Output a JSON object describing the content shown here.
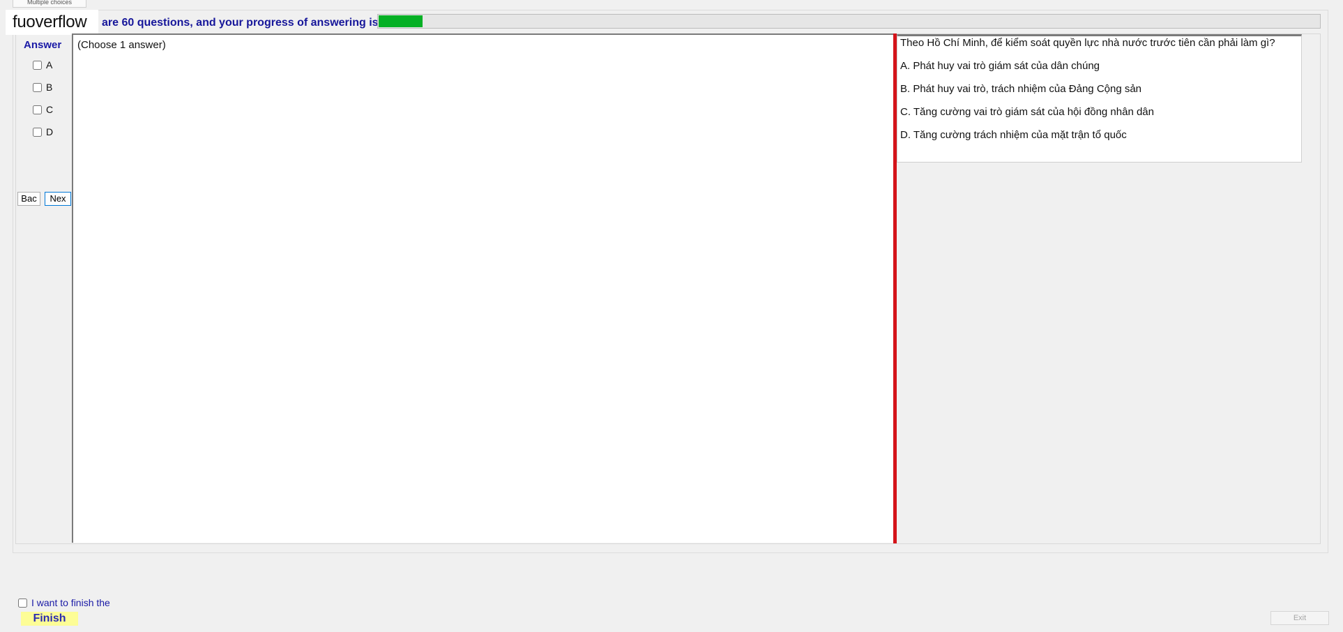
{
  "window": {
    "tab_label": "Multiple choices"
  },
  "header": {
    "logo_text": "fuoverflow",
    "status_text": "are 60 questions, and your progress of answering is",
    "progress_fraction": 0.047,
    "progress_color": "#06b025"
  },
  "answer_panel": {
    "title": "Answer",
    "options": [
      {
        "label": "A",
        "checked": false
      },
      {
        "label": "B",
        "checked": false
      },
      {
        "label": "C",
        "checked": false
      },
      {
        "label": "D",
        "checked": false
      }
    ],
    "back_label": "Bac",
    "next_label": "Nex"
  },
  "answer_area": {
    "note": "(Choose 1 answer)"
  },
  "question": {
    "text": "Theo Hồ Chí Minh, để kiểm soát quyền lực nhà nước trước tiên cần phải làm gì?",
    "choices": [
      "A.  Phát huy vai trò giám sát của dân chúng",
      "B.  Phát huy vai trò, trách nhiệm của Đảng Cộng sản",
      "C.  Tăng cường vai trò giám sát của hội đồng nhân dân",
      "D.  Tăng cường trách nhiệm của mặt trận tổ quốc"
    ]
  },
  "footer": {
    "finish_check_label": "I want to finish the",
    "finish_label": "Finish",
    "exit_label": "Exit"
  },
  "colors": {
    "splitter": "#d4141a",
    "header_text": "#16169a",
    "finish_bg": "#fdfd96"
  }
}
